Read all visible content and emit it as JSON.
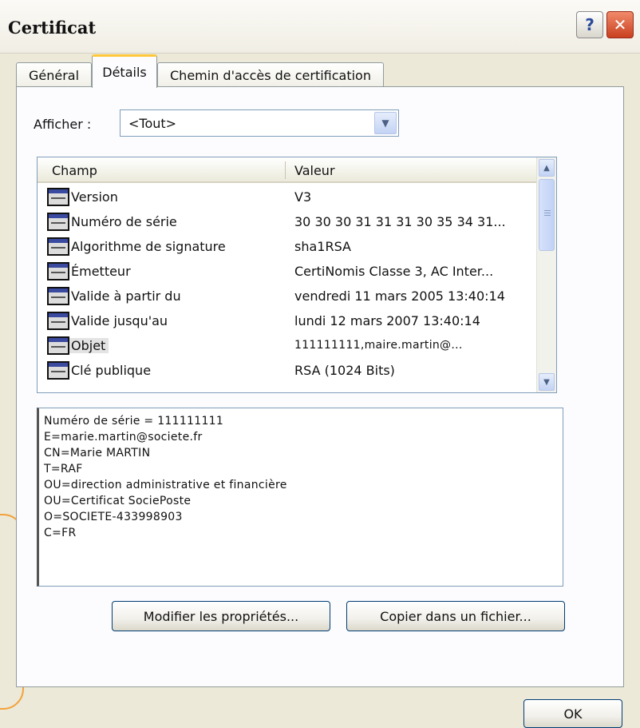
{
  "window": {
    "title": "Certificat"
  },
  "tabs": [
    {
      "label": "Général"
    },
    {
      "label": "Détails"
    },
    {
      "label": "Chemin d'accès de certification"
    }
  ],
  "afficher": {
    "label": "Afficher :",
    "value": "<Tout>"
  },
  "list": {
    "headers": {
      "field": "Champ",
      "value": "Valeur"
    },
    "rows": [
      {
        "field": "Version",
        "value": "V3"
      },
      {
        "field": "Numéro de série",
        "value": "30 30 30 31 31 31 30 35 34 31..."
      },
      {
        "field": "Algorithme de signature",
        "value": "sha1RSA"
      },
      {
        "field": "Émetteur",
        "value": "CertiNomis Classe 3, AC Inter..."
      },
      {
        "field": "Valide à partir du",
        "value": "vendredi 11 mars 2005 13:40:14"
      },
      {
        "field": "Valide jusqu'au",
        "value": "lundi 12 mars 2007 13:40:14"
      },
      {
        "field": "Objet",
        "value": "111111111,maire.martin@..."
      },
      {
        "field": "Clé publique",
        "value": "RSA (1024 Bits)"
      }
    ]
  },
  "detail": {
    "lines": [
      "Numéro de série = 111111111",
      "E=marie.martin@societe.fr",
      "CN=Marie MARTIN",
      "T=RAF",
      "OU=direction administrative et financière",
      "OU=Certificat SociePoste",
      "O=SOCIETE-433998903",
      "C=FR"
    ]
  },
  "buttons": {
    "modifier": "Modifier les propriétés...",
    "copier": "Copier dans un fichier...",
    "ok": "OK"
  }
}
